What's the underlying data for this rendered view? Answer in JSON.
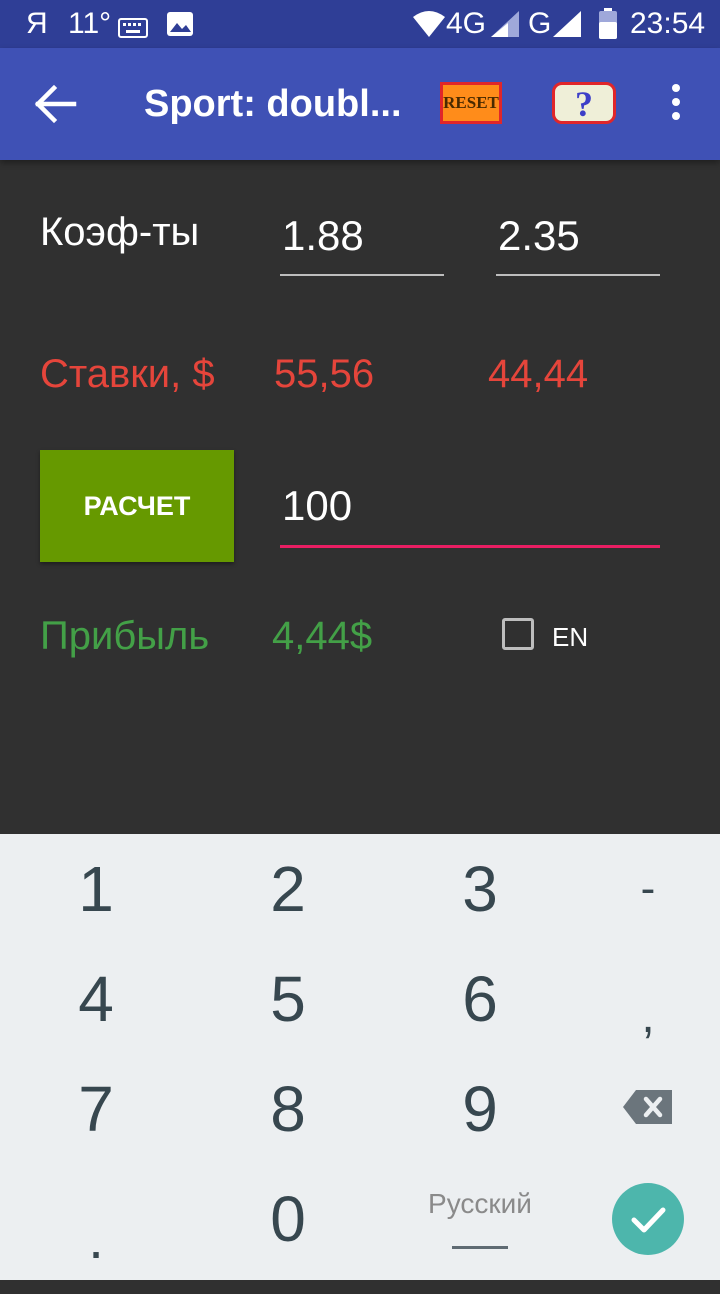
{
  "status_bar": {
    "yandex": "Я",
    "temperature": "11°",
    "network_4g": "4G",
    "network_g": "G",
    "time": "23:54"
  },
  "app_bar": {
    "title": "Sport: doubl...",
    "reset_label": "RESET",
    "help_label": "?"
  },
  "odds": {
    "label": "Коэф-ты",
    "value1": "1.88",
    "value2": "2.35"
  },
  "stakes": {
    "label": "Ставки, $",
    "value1": "55,56",
    "value2": "44,44"
  },
  "calculate": {
    "button_label": "РАСЧЕТ",
    "amount": "100"
  },
  "profit": {
    "label": "Прибыль",
    "value": "4,44$",
    "checkbox_label": "EN"
  },
  "keyboard": {
    "keys": [
      "1",
      "2",
      "3",
      "-",
      "4",
      "5",
      "6",
      ",",
      "7",
      "8",
      "9",
      ".",
      "0"
    ],
    "language": "Русский"
  },
  "colors": {
    "app_bar": "#3f51b5",
    "stakes": "#e5453b",
    "profit": "#43a047",
    "calc_button": "#669900",
    "accent": "#e91e63"
  }
}
